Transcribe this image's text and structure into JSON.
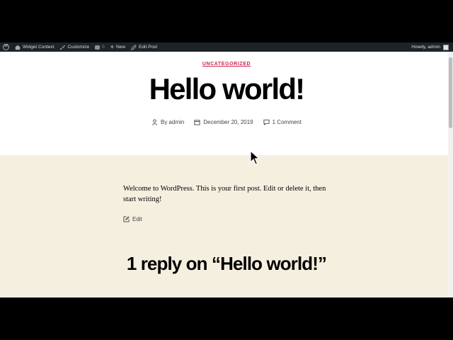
{
  "adminbar": {
    "site_name": "Widget Context",
    "customize": "Customize",
    "comments_count": "0",
    "new_label": "New",
    "edit_post": "Edit Post",
    "howdy": "Howdy, admin"
  },
  "post": {
    "category": "UNCATEGORIZED",
    "title": "Hello world!",
    "author": "By admin",
    "date": "December 20, 2019",
    "comments": "1 Comment",
    "content": "Welcome to WordPress. This is your first post. Edit or delete it, then start writing!",
    "edit_label": "Edit",
    "replies_heading": "1 reply on “Hello world!”"
  },
  "colors": {
    "accent": "#cd2653",
    "content_bg": "#f5efe0",
    "adminbar_bg": "#1d2327"
  }
}
